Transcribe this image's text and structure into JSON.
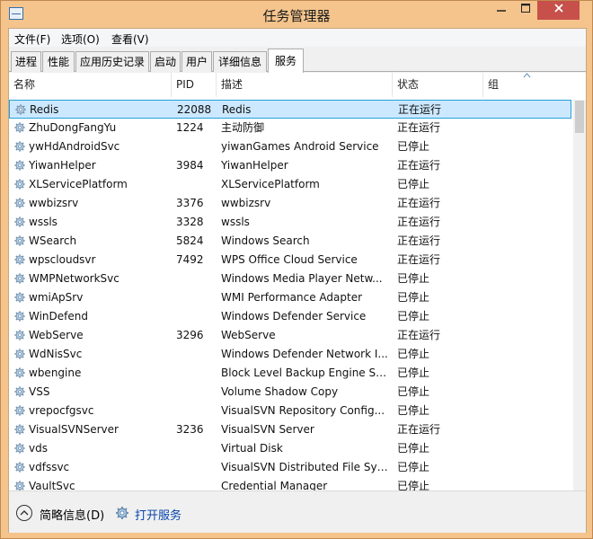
{
  "window": {
    "title": "任务管理器"
  },
  "menu": [
    "文件(F)",
    "选项(O)",
    "查看(V)"
  ],
  "tabs": [
    "进程",
    "性能",
    "应用历史记录",
    "启动",
    "用户",
    "详细信息",
    "服务"
  ],
  "active_tab": "服务",
  "columns": {
    "name": "名称",
    "pid": "PID",
    "desc": "描述",
    "status": "状态",
    "group": "组"
  },
  "services": [
    {
      "name": "Redis",
      "pid": "22088",
      "desc": "Redis",
      "status": "正在运行"
    },
    {
      "name": "ZhuDongFangYu",
      "pid": "1224",
      "desc": "主动防御",
      "status": "正在运行"
    },
    {
      "name": "ywHdAndroidSvc",
      "pid": "",
      "desc": "yiwanGames Android Service",
      "status": "已停止"
    },
    {
      "name": "YiwanHelper",
      "pid": "3984",
      "desc": "YiwanHelper",
      "status": "正在运行"
    },
    {
      "name": "XLServicePlatform",
      "pid": "",
      "desc": "XLServicePlatform",
      "status": "已停止"
    },
    {
      "name": "wwbizsrv",
      "pid": "3376",
      "desc": "wwbizsrv",
      "status": "正在运行"
    },
    {
      "name": "wssls",
      "pid": "3328",
      "desc": "wssls",
      "status": "正在运行"
    },
    {
      "name": "WSearch",
      "pid": "5824",
      "desc": "Windows Search",
      "status": "正在运行"
    },
    {
      "name": "wpscloudsvr",
      "pid": "7492",
      "desc": "WPS Office Cloud Service",
      "status": "正在运行"
    },
    {
      "name": "WMPNetworkSvc",
      "pid": "",
      "desc": "Windows Media Player Netw...",
      "status": "已停止"
    },
    {
      "name": "wmiApSrv",
      "pid": "",
      "desc": "WMI Performance Adapter",
      "status": "已停止"
    },
    {
      "name": "WinDefend",
      "pid": "",
      "desc": "Windows Defender Service",
      "status": "已停止"
    },
    {
      "name": "WebServe",
      "pid": "3296",
      "desc": "WebServe",
      "status": "正在运行"
    },
    {
      "name": "WdNisSvc",
      "pid": "",
      "desc": "Windows Defender Network I...",
      "status": "已停止"
    },
    {
      "name": "wbengine",
      "pid": "",
      "desc": "Block Level Backup Engine Se...",
      "status": "已停止"
    },
    {
      "name": "VSS",
      "pid": "",
      "desc": "Volume Shadow Copy",
      "status": "已停止"
    },
    {
      "name": "vrepocfgsvc",
      "pid": "",
      "desc": "VisualSVN Repository Config...",
      "status": "已停止"
    },
    {
      "name": "VisualSVNServer",
      "pid": "3236",
      "desc": "VisualSVN Server",
      "status": "正在运行"
    },
    {
      "name": "vds",
      "pid": "",
      "desc": "Virtual Disk",
      "status": "已停止"
    },
    {
      "name": "vdfssvc",
      "pid": "",
      "desc": "VisualSVN Distributed File Sys...",
      "status": "已停止"
    },
    {
      "name": "VaultSvc",
      "pid": "",
      "desc": "Credential Manager",
      "status": "已停止"
    }
  ],
  "selected_service": "Redis",
  "footer": {
    "fewer_details": "简略信息(D)",
    "open_services": "打开服务"
  },
  "colors": {
    "selection": "#cce8ff",
    "selection_border": "#26a0da",
    "titlebar": "#f4c48c",
    "close_button": "#c7504a",
    "link": "#0645ad"
  }
}
